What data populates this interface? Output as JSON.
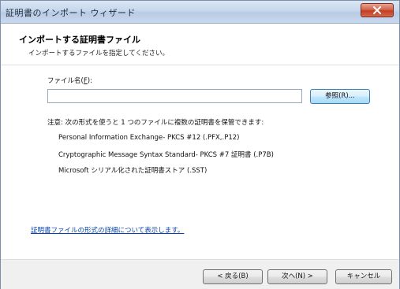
{
  "window": {
    "title": "証明書のインポート ウィザード"
  },
  "header": {
    "title": "インポートする証明書ファイル",
    "subtitle": "インポートするファイルを指定してください。"
  },
  "form": {
    "filename_label": "ファイル名(",
    "filename_access_key": "F",
    "filename_label_suffix": "):",
    "filename_value": "",
    "browse_label": "参照(R)..."
  },
  "note": {
    "intro": "注意: 次の形式を使うと 1 つのファイルに複数の証明書を保管できます:",
    "formats": [
      "Personal Information Exchange- PKCS #12 (.PFX,.P12)",
      "Cryptographic Message Syntax Standard- PKCS #7 証明書 (.P7B)",
      "Microsoft シリアル化された証明書ストア (.SST)"
    ]
  },
  "link": {
    "text": "証明書ファイルの形式の詳細について表示します。"
  },
  "footer": {
    "back_label": "< 戻る(B)",
    "next_label": "次へ(N) >",
    "cancel_label": "キャンセル"
  },
  "colors": {
    "accent": "#3c7fb1",
    "link": "#0645ad",
    "close": "#c43d22"
  }
}
